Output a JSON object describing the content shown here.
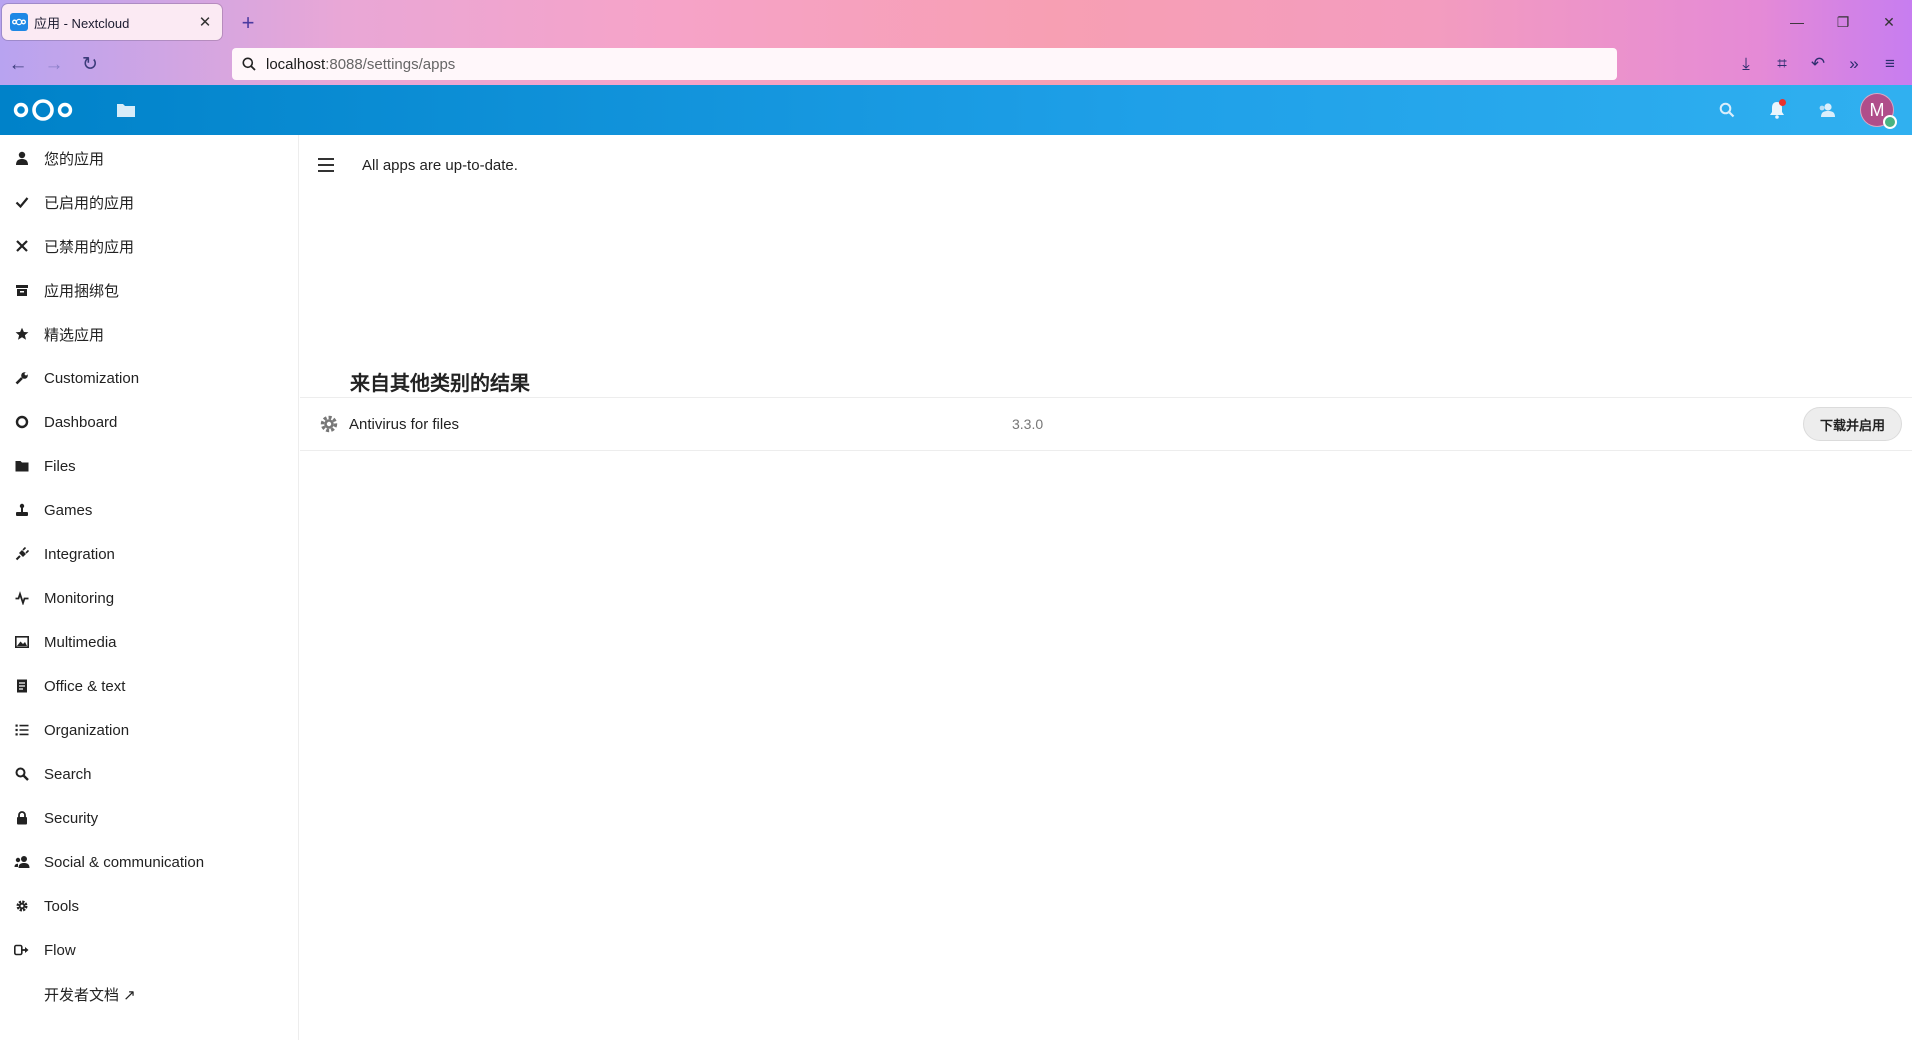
{
  "browser": {
    "tab_title": "应用 - Nextcloud",
    "tab_close": "✕",
    "new_tab": "+",
    "url_host": "localhost",
    "url_path": ":8088/settings/apps",
    "window_controls": {
      "minimize": "—",
      "restore": "❐",
      "close": "✕"
    }
  },
  "header": {
    "avatar_letter": "M",
    "brand_color": "#0082c9"
  },
  "sidebar": {
    "items": [
      {
        "label": "您的应用",
        "icon": "user-icon"
      },
      {
        "label": "已启用的应用",
        "icon": "check-icon"
      },
      {
        "label": "已禁用的应用",
        "icon": "close-icon"
      },
      {
        "label": "应用捆绑包",
        "icon": "archive-icon"
      },
      {
        "label": "精选应用",
        "icon": "star-icon"
      },
      {
        "label": "Customization",
        "icon": "wrench-icon"
      },
      {
        "label": "Dashboard",
        "icon": "circle-icon"
      },
      {
        "label": "Files",
        "icon": "folder-icon"
      },
      {
        "label": "Games",
        "icon": "joystick-icon"
      },
      {
        "label": "Integration",
        "icon": "plug-icon"
      },
      {
        "label": "Monitoring",
        "icon": "pulse-icon"
      },
      {
        "label": "Multimedia",
        "icon": "image-icon"
      },
      {
        "label": "Office & text",
        "icon": "document-icon"
      },
      {
        "label": "Organization",
        "icon": "list-icon"
      },
      {
        "label": "Search",
        "icon": "search-icon"
      },
      {
        "label": "Security",
        "icon": "lock-icon"
      },
      {
        "label": "Social & communication",
        "icon": "users-icon"
      },
      {
        "label": "Tools",
        "icon": "gear-icon"
      },
      {
        "label": "Flow",
        "icon": "flow-icon"
      }
    ],
    "dev_docs_label": "开发者文档 ↗"
  },
  "main": {
    "status_text": "All apps are up-to-date.",
    "section_title": "来自其他类别的结果",
    "apps": [
      {
        "name": "Antivirus for files",
        "version": "3.3.0",
        "action": "下载并启用"
      }
    ]
  }
}
